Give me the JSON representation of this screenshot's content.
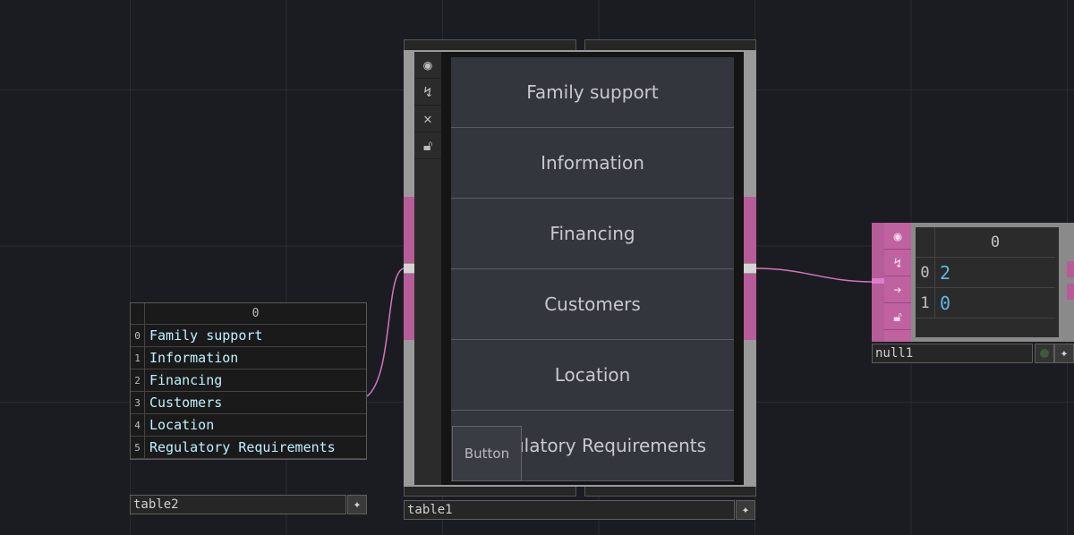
{
  "table2": {
    "name": "table2",
    "column_header": "0",
    "rows": [
      {
        "index": "0",
        "value": "Family support"
      },
      {
        "index": "1",
        "value": "Information"
      },
      {
        "index": "2",
        "value": "Financing"
      },
      {
        "index": "3",
        "value": "Customers"
      },
      {
        "index": "4",
        "value": "Location"
      },
      {
        "index": "5",
        "value": "Regulatory Requirements"
      }
    ],
    "add_icon": "sparkle-icon"
  },
  "table1": {
    "name": "table1",
    "toolbar_icons": [
      "viewer-icon",
      "bypass-icon",
      "close-icon",
      "lock-icon"
    ],
    "cells": [
      "Family support",
      "Information",
      "Financing",
      "Customers",
      "Location",
      "Regulatory Requirements"
    ],
    "button_label": "Button",
    "add_icon": "sparkle-icon"
  },
  "null1": {
    "name": "null1",
    "column_header": "0",
    "rows": [
      {
        "index": "0",
        "value": "2"
      },
      {
        "index": "1",
        "value": "0"
      }
    ],
    "toolbar_icons": [
      "viewer-icon",
      "bypass-icon",
      "display-icon",
      "lock-icon"
    ],
    "add_icon": "sparkle-icon"
  },
  "colors": {
    "background": "#1b1c21",
    "wire": "#d774c0",
    "operator_pink": "#b65c98",
    "table_text": "#bdf3ff",
    "value_blue": "#5ab9e6"
  }
}
